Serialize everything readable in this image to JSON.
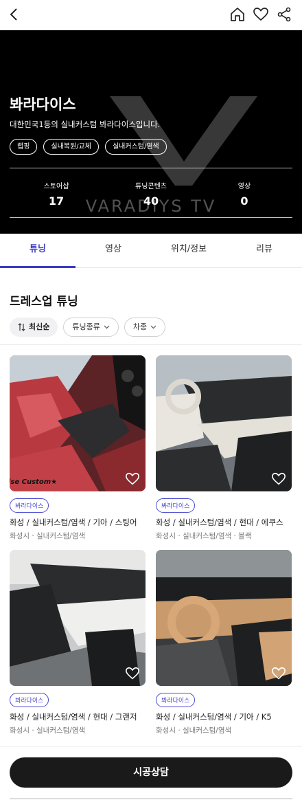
{
  "hero": {
    "title": "봐라다이스",
    "description": "대한민국1등의 실내커스텀 봐라다이스입니다.",
    "tags": [
      "랩핑",
      "실내복원/교체",
      "실내커스텀/염색"
    ],
    "watermark": "VARADIYS TV",
    "stats": [
      {
        "label": "스토어샵",
        "value": "17"
      },
      {
        "label": "튜닝콘텐츠",
        "value": "40"
      },
      {
        "label": "영상",
        "value": "0"
      }
    ]
  },
  "tabs": [
    "튜닝",
    "영상",
    "위치/정보",
    "리뷰"
  ],
  "section": {
    "title": "드레스업 튜닝",
    "sort_label": "최신순",
    "filter_type": "튜닝종류",
    "filter_car": "차종"
  },
  "cards": [
    {
      "badge": "봐라다이스",
      "name": "화성 / 실내커스텀/염색 / 기아 / 스팅어",
      "sub": "화성시 · 실내커스텀/염색",
      "overlay": "ise Custom★"
    },
    {
      "badge": "봐라다이스",
      "name": "화성 / 실내커스텀/염색 / 현대 / 에쿠스",
      "sub": "화성시 · 실내커스텀/염색 · 블랙",
      "overlay": ""
    },
    {
      "badge": "봐라다이스",
      "name": "화성 / 실내커스텀/염색 / 현대 / 그랜저",
      "sub": "화성시 · 실내커스텀/염색",
      "overlay": ""
    },
    {
      "badge": "봐라다이스",
      "name": "화성 / 실내커스텀/염색 / 기아 / K5",
      "sub": "화성시 · 실내커스텀/염색",
      "overlay": ""
    }
  ],
  "cta": {
    "label": "시공상담"
  },
  "colors": {
    "accent": "#3b3bc4",
    "hero_bg": "#000000",
    "cta_bg": "#1a1a1a"
  }
}
